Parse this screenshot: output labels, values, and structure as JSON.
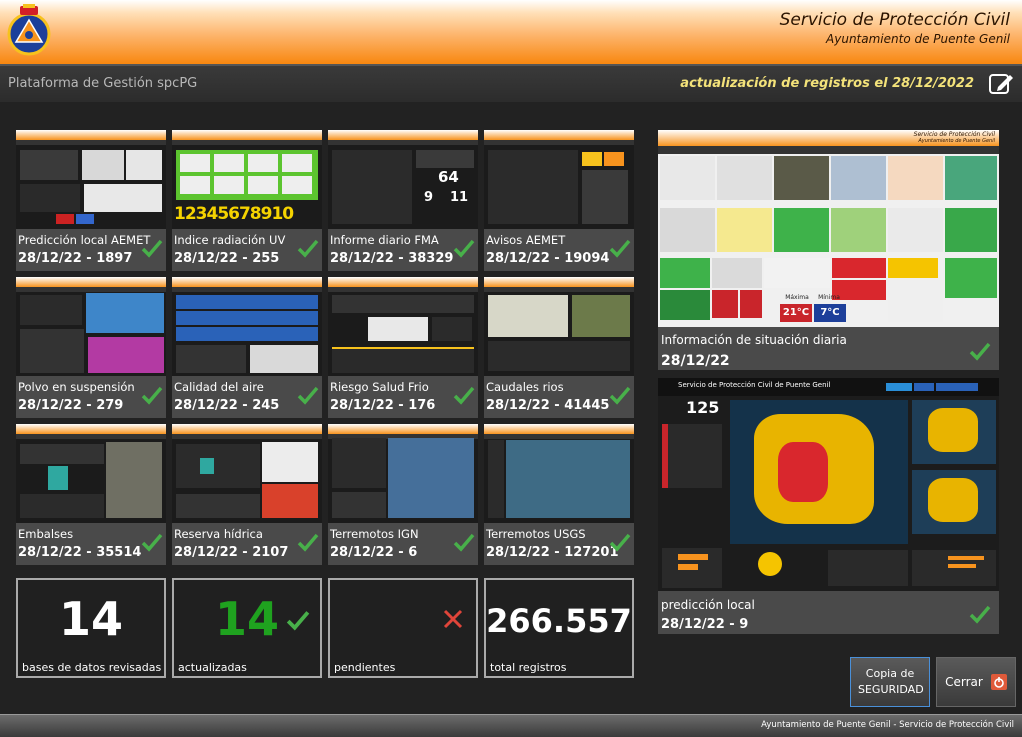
{
  "header": {
    "title": "Servicio de Protección Civil",
    "subtitle": "Ayuntamiento de Puente Genil"
  },
  "topbar": {
    "platform": "Plataforma de Gestión spcPG",
    "update_text": "actualización de registros el 28/12/2022"
  },
  "tiles": [
    {
      "title": "Predicción local AEMET",
      "meta": "28/12/22 - 1897"
    },
    {
      "title": "Indice radiación UV",
      "meta": "28/12/22 - 255"
    },
    {
      "title": "Informe diario FMA",
      "meta": "28/12/22 - 38329"
    },
    {
      "title": "Avisos AEMET",
      "meta": "28/12/22 - 19094"
    },
    {
      "title": "Polvo en suspensión",
      "meta": "28/12/22 - 279"
    },
    {
      "title": "Calidad del aire",
      "meta": "28/12/22 - 245"
    },
    {
      "title": "Riesgo Salud Frio",
      "meta": "28/12/22 - 176"
    },
    {
      "title": "Caudales rios",
      "meta": "28/12/22 - 41445"
    },
    {
      "title": "Embalses",
      "meta": "28/12/22 - 35514"
    },
    {
      "title": "Reserva hídrica",
      "meta": "28/12/22 - 2107"
    },
    {
      "title": "Terremotos IGN",
      "meta": "28/12/22 - 6"
    },
    {
      "title": "Terremotos USGS",
      "meta": "28/12/22 - 127201"
    }
  ],
  "stats": {
    "revised": {
      "value": "14",
      "label": "bases de datos revisadas"
    },
    "updated": {
      "value": "14",
      "label": "actualizadas"
    },
    "pending": {
      "value": "",
      "label": "pendientes"
    },
    "total": {
      "value": "266.557",
      "label": "total registros"
    }
  },
  "big_tiles": {
    "situacion": {
      "title": "Información de situación diaria",
      "meta": "28/12/22"
    },
    "prediccion": {
      "title": "predicción local",
      "meta": "28/12/22 - 9"
    }
  },
  "thumb_texts": {
    "mini_title": "Servicio de Protección Civil",
    "mini_sub": "Ayuntamiento de Puente Genil",
    "max_temp": "21°C",
    "min_temp": "7°C",
    "max_label": "Máxima",
    "min_label": "Mínima",
    "pred_title": "Servicio de Protección Civil de Puente Genil",
    "pred_number": "125",
    "uv_digits": "12345678910",
    "fma_numbers": [
      "64",
      "9",
      "11"
    ]
  },
  "buttons": {
    "backup": "Copia de SEGURIDAD",
    "close": "Cerrar"
  },
  "footer": {
    "text": "Ayuntamiento de Puente Genil - Servicio de Protección Civil"
  },
  "colors": {
    "check": "#48b04a",
    "pending_x": "#e0453a",
    "accent_orange": "#f7931e",
    "update_text": "#f3e27a",
    "updated_number": "#1fa21f"
  }
}
